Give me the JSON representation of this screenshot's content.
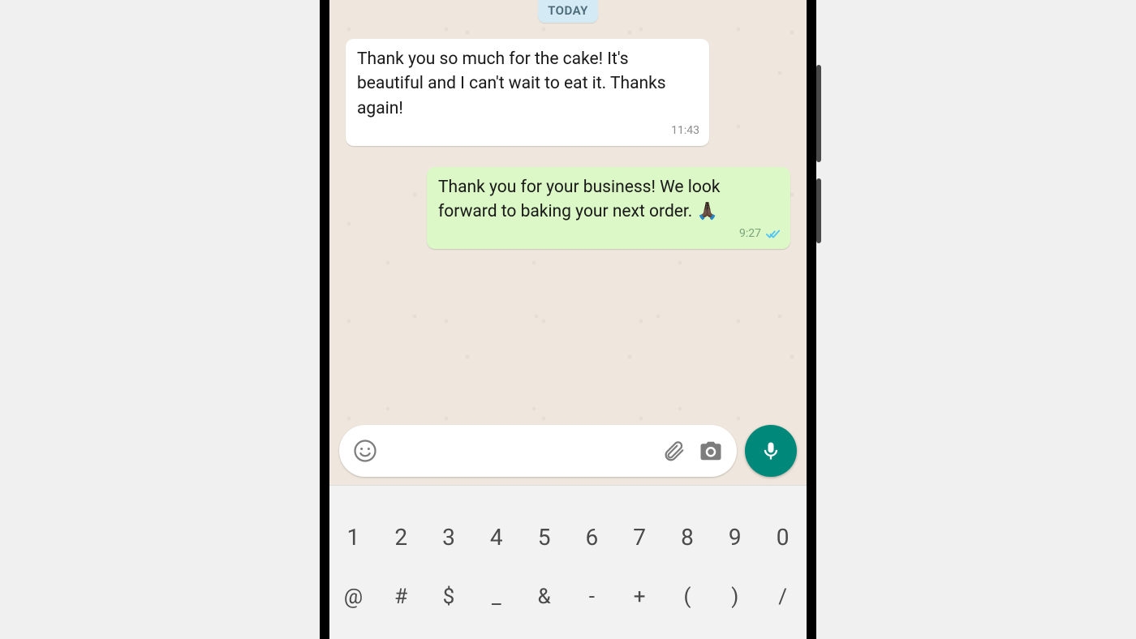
{
  "date_label": "TODAY",
  "messages": {
    "incoming": {
      "text": "Thank you so much for the cake! It's beautiful and I can't wait to eat it. Thanks again!",
      "time": "11:43"
    },
    "outgoing": {
      "text": "Thank you for your business! We look forward to baking your next order. 🙏🏿",
      "time": "9:27"
    }
  },
  "input": {
    "placeholder": ""
  },
  "icons": {
    "emoji": "emoji-icon",
    "attach": "paperclip-icon",
    "camera": "camera-icon",
    "mic": "microphone-icon",
    "read_ticks": "double-check-icon"
  },
  "keyboard": {
    "row1": [
      "1",
      "2",
      "3",
      "4",
      "5",
      "6",
      "7",
      "8",
      "9",
      "0"
    ],
    "row2": [
      "@",
      "#",
      "$",
      "_",
      "&",
      "-",
      "+",
      "(",
      ")",
      "/"
    ]
  },
  "colors": {
    "chat_bg": "#efe7dd",
    "bubble_in": "#ffffff",
    "bubble_out": "#dcf8c6",
    "accent": "#00897b",
    "date_pill": "#d4eaf4",
    "tick_read": "#4fc3f7"
  }
}
